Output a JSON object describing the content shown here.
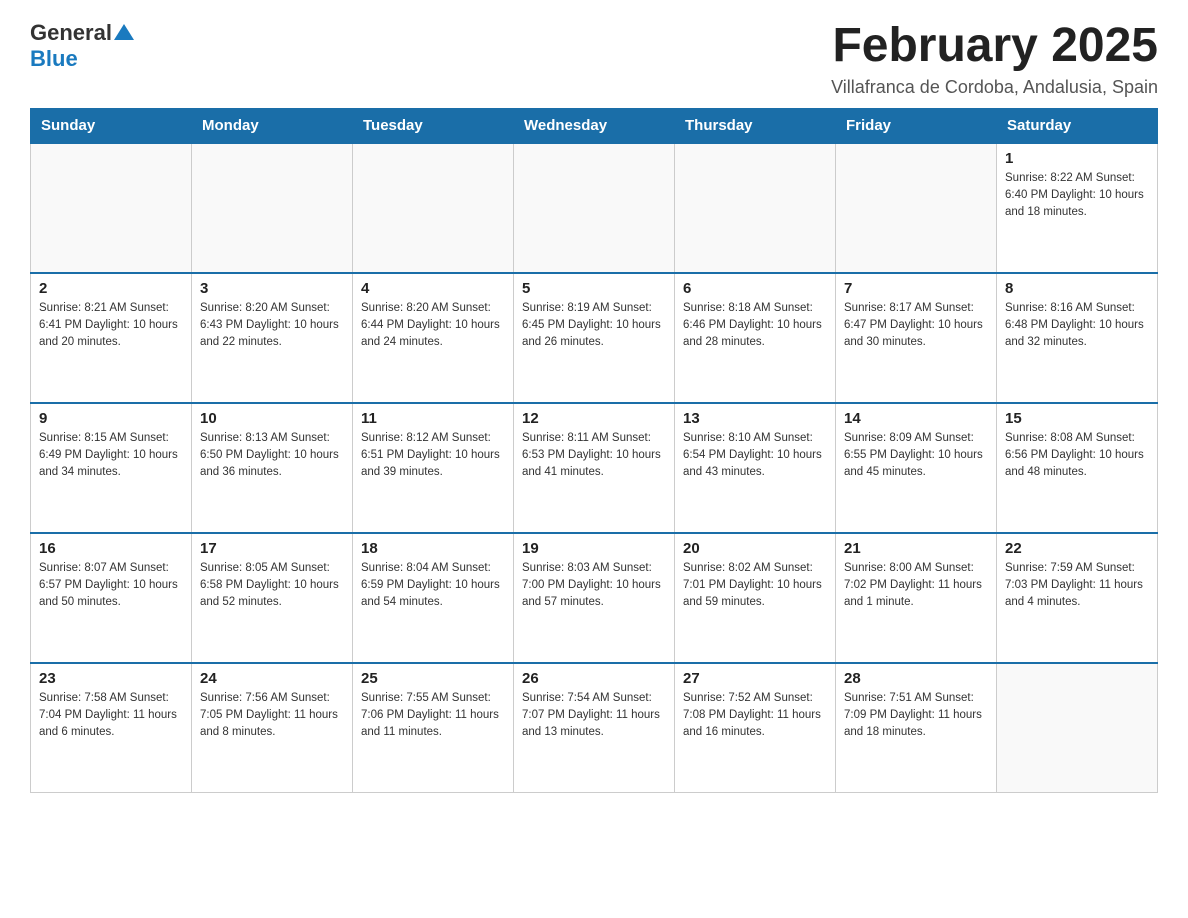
{
  "logo": {
    "general": "General",
    "blue": "Blue"
  },
  "header": {
    "title": "February 2025",
    "location": "Villafranca de Cordoba, Andalusia, Spain"
  },
  "weekdays": [
    "Sunday",
    "Monday",
    "Tuesday",
    "Wednesday",
    "Thursday",
    "Friday",
    "Saturday"
  ],
  "weeks": [
    {
      "days": [
        {
          "num": "",
          "info": ""
        },
        {
          "num": "",
          "info": ""
        },
        {
          "num": "",
          "info": ""
        },
        {
          "num": "",
          "info": ""
        },
        {
          "num": "",
          "info": ""
        },
        {
          "num": "",
          "info": ""
        },
        {
          "num": "1",
          "info": "Sunrise: 8:22 AM\nSunset: 6:40 PM\nDaylight: 10 hours\nand 18 minutes."
        }
      ]
    },
    {
      "days": [
        {
          "num": "2",
          "info": "Sunrise: 8:21 AM\nSunset: 6:41 PM\nDaylight: 10 hours\nand 20 minutes."
        },
        {
          "num": "3",
          "info": "Sunrise: 8:20 AM\nSunset: 6:43 PM\nDaylight: 10 hours\nand 22 minutes."
        },
        {
          "num": "4",
          "info": "Sunrise: 8:20 AM\nSunset: 6:44 PM\nDaylight: 10 hours\nand 24 minutes."
        },
        {
          "num": "5",
          "info": "Sunrise: 8:19 AM\nSunset: 6:45 PM\nDaylight: 10 hours\nand 26 minutes."
        },
        {
          "num": "6",
          "info": "Sunrise: 8:18 AM\nSunset: 6:46 PM\nDaylight: 10 hours\nand 28 minutes."
        },
        {
          "num": "7",
          "info": "Sunrise: 8:17 AM\nSunset: 6:47 PM\nDaylight: 10 hours\nand 30 minutes."
        },
        {
          "num": "8",
          "info": "Sunrise: 8:16 AM\nSunset: 6:48 PM\nDaylight: 10 hours\nand 32 minutes."
        }
      ]
    },
    {
      "days": [
        {
          "num": "9",
          "info": "Sunrise: 8:15 AM\nSunset: 6:49 PM\nDaylight: 10 hours\nand 34 minutes."
        },
        {
          "num": "10",
          "info": "Sunrise: 8:13 AM\nSunset: 6:50 PM\nDaylight: 10 hours\nand 36 minutes."
        },
        {
          "num": "11",
          "info": "Sunrise: 8:12 AM\nSunset: 6:51 PM\nDaylight: 10 hours\nand 39 minutes."
        },
        {
          "num": "12",
          "info": "Sunrise: 8:11 AM\nSunset: 6:53 PM\nDaylight: 10 hours\nand 41 minutes."
        },
        {
          "num": "13",
          "info": "Sunrise: 8:10 AM\nSunset: 6:54 PM\nDaylight: 10 hours\nand 43 minutes."
        },
        {
          "num": "14",
          "info": "Sunrise: 8:09 AM\nSunset: 6:55 PM\nDaylight: 10 hours\nand 45 minutes."
        },
        {
          "num": "15",
          "info": "Sunrise: 8:08 AM\nSunset: 6:56 PM\nDaylight: 10 hours\nand 48 minutes."
        }
      ]
    },
    {
      "days": [
        {
          "num": "16",
          "info": "Sunrise: 8:07 AM\nSunset: 6:57 PM\nDaylight: 10 hours\nand 50 minutes."
        },
        {
          "num": "17",
          "info": "Sunrise: 8:05 AM\nSunset: 6:58 PM\nDaylight: 10 hours\nand 52 minutes."
        },
        {
          "num": "18",
          "info": "Sunrise: 8:04 AM\nSunset: 6:59 PM\nDaylight: 10 hours\nand 54 minutes."
        },
        {
          "num": "19",
          "info": "Sunrise: 8:03 AM\nSunset: 7:00 PM\nDaylight: 10 hours\nand 57 minutes."
        },
        {
          "num": "20",
          "info": "Sunrise: 8:02 AM\nSunset: 7:01 PM\nDaylight: 10 hours\nand 59 minutes."
        },
        {
          "num": "21",
          "info": "Sunrise: 8:00 AM\nSunset: 7:02 PM\nDaylight: 11 hours\nand 1 minute."
        },
        {
          "num": "22",
          "info": "Sunrise: 7:59 AM\nSunset: 7:03 PM\nDaylight: 11 hours\nand 4 minutes."
        }
      ]
    },
    {
      "days": [
        {
          "num": "23",
          "info": "Sunrise: 7:58 AM\nSunset: 7:04 PM\nDaylight: 11 hours\nand 6 minutes."
        },
        {
          "num": "24",
          "info": "Sunrise: 7:56 AM\nSunset: 7:05 PM\nDaylight: 11 hours\nand 8 minutes."
        },
        {
          "num": "25",
          "info": "Sunrise: 7:55 AM\nSunset: 7:06 PM\nDaylight: 11 hours\nand 11 minutes."
        },
        {
          "num": "26",
          "info": "Sunrise: 7:54 AM\nSunset: 7:07 PM\nDaylight: 11 hours\nand 13 minutes."
        },
        {
          "num": "27",
          "info": "Sunrise: 7:52 AM\nSunset: 7:08 PM\nDaylight: 11 hours\nand 16 minutes."
        },
        {
          "num": "28",
          "info": "Sunrise: 7:51 AM\nSunset: 7:09 PM\nDaylight: 11 hours\nand 18 minutes."
        },
        {
          "num": "",
          "info": ""
        }
      ]
    }
  ]
}
